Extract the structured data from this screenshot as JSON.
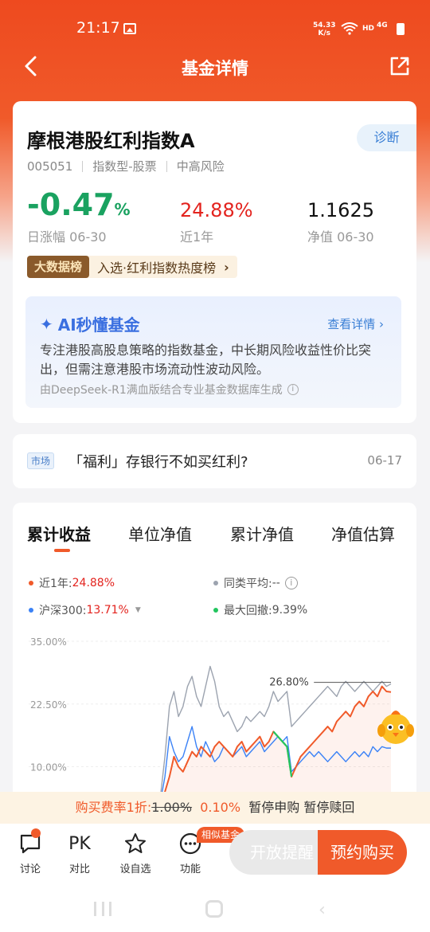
{
  "status": {
    "time": "21:17",
    "speed_top": "54.33",
    "speed_bottom": "K/s",
    "hd": "HD",
    "net": "4G"
  },
  "nav": {
    "title": "基金详情"
  },
  "fund": {
    "name": "摩根港股红利指数A",
    "code": "005051",
    "type": "指数型-股票",
    "risk": "中高风险",
    "diagnose_label": "诊断",
    "day_change_value": "-0.47",
    "day_change_unit": "%",
    "day_change_label": "日涨幅 06-30",
    "year_return_value": "24.88%",
    "year_return_label": "近1年",
    "nav_value": "1.1625",
    "nav_label": "净值 06-30",
    "bigdata_badge": "大数据榜",
    "bigdata_text": "入选·红利指数热度榜",
    "bigdata_arrow": "›"
  },
  "ai": {
    "title": "AI秒懂基金",
    "more": "查看详情 ›",
    "text": "专注港股高股息策略的指数基金，中长期风险收益性价比突出，但需注意港股市场流动性波动风险。",
    "source": "由DeepSeek-R1满血版结合专业基金数据库生成"
  },
  "news": {
    "tag": "市场",
    "text": "「福利」存银行不如买红利?",
    "date": "06-17"
  },
  "chart_tabs": [
    "累计收益",
    "单位净值",
    "累计净值",
    "净值估算"
  ],
  "legend": {
    "fund_label": "近1年:",
    "fund_value": "24.88%",
    "peer_label": "同类平均:",
    "peer_value": "--",
    "index_label": "沪深300:",
    "index_value": "13.71%",
    "drawdown_label": "最大回撤:",
    "drawdown_value": "9.39%"
  },
  "chart_data": {
    "type": "line",
    "ylim": [
      5,
      35
    ],
    "yticks": [
      "35.00%",
      "22.50%",
      "10.00%"
    ],
    "ytick_values": [
      35,
      22.5,
      10
    ],
    "peak_label": "26.80%",
    "series": [
      {
        "name": "近1年",
        "color": "#f05a2a",
        "values": [
          0,
          0,
          0,
          0,
          0,
          0,
          0,
          0,
          2,
          5,
          8,
          12,
          10,
          9,
          11,
          13,
          12,
          14,
          13,
          12,
          14,
          15,
          14,
          13,
          12,
          14,
          15,
          13,
          14,
          15,
          16,
          14,
          15,
          17,
          16,
          15,
          14,
          8,
          10,
          12,
          13,
          14,
          15,
          16,
          17,
          18,
          17,
          19,
          20,
          21,
          20,
          22,
          23,
          22,
          24,
          25,
          24,
          26,
          25,
          24.88
        ]
      },
      {
        "name": "沪深300",
        "color": "#3b82f6",
        "values": [
          0,
          0,
          0,
          0,
          0,
          0,
          0,
          0,
          3,
          8,
          16,
          13,
          11,
          12,
          15,
          18,
          14,
          12,
          15,
          13,
          11,
          12,
          14,
          13,
          12,
          13,
          14,
          12,
          13,
          14,
          15,
          13,
          14,
          15,
          16,
          15,
          16,
          9,
          10,
          11,
          12,
          13,
          12,
          13,
          12,
          11,
          12,
          13,
          12,
          11,
          12,
          13,
          12,
          13,
          12,
          14,
          13,
          14,
          13.71,
          13.71
        ]
      },
      {
        "name": "同类平均",
        "color": "#9ca3af",
        "values": [
          0,
          0,
          0,
          0,
          0,
          0,
          0,
          0,
          4,
          12,
          22,
          25,
          20,
          22,
          26,
          28,
          24,
          22,
          26,
          30,
          27,
          22,
          20,
          21,
          19,
          17,
          18,
          20,
          19,
          20,
          21,
          20,
          22,
          25,
          23,
          24,
          25,
          18,
          19,
          20,
          21,
          22,
          23,
          24,
          25,
          26,
          25,
          24,
          26,
          27,
          26,
          25,
          26,
          27,
          26,
          25,
          26,
          27,
          26,
          26.5
        ]
      }
    ],
    "drawdown_color": "#22c55e"
  },
  "mascot_icon": "chick-mascot",
  "fee": {
    "prefix": "购买费率1折:",
    "original": "1.00%",
    "discount": "0.10%",
    "status": "暂停申购 暂停赎回"
  },
  "bottom": {
    "discuss": "讨论",
    "compare_icon": "PK",
    "compare": "对比",
    "watch": "设自选",
    "func": "功能",
    "similar_badge": "相似基金",
    "remind": "开放提醒",
    "buy": "预约购买"
  }
}
